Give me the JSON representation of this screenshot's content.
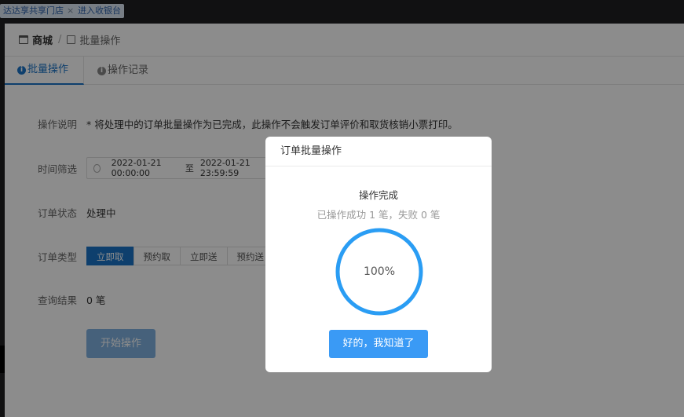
{
  "topbar": {
    "tabs": [
      {
        "label": "达达享共享门店",
        "close": "×"
      },
      {
        "label": "进入收银台"
      }
    ]
  },
  "breadcrumb": {
    "root": "商城",
    "separator": "/",
    "current": "批量操作"
  },
  "tabs": {
    "active": "批量操作",
    "inactive": "操作记录"
  },
  "form": {
    "desc_label": "操作说明",
    "desc_value": "* 将处理中的订单批量操作为已完成，此操作不会触发订单评价和取货核销小票打印。",
    "time_label": "时间筛选",
    "time_start": "2022-01-21 00:00:00",
    "time_sep": "至",
    "time_end": "2022-01-21 23:59:59",
    "status_label": "订单状态",
    "status_value": "处理中",
    "type_label": "订单类型",
    "type_options": [
      "立即取",
      "预约取",
      "立即送",
      "预约送"
    ],
    "result_label": "查询结果",
    "result_value": "0 笔",
    "start_button": "开始操作"
  },
  "modal": {
    "title": "订单批量操作",
    "status": "操作完成",
    "summary": "已操作成功 1 笔，失败 0 笔",
    "progress_percent": 100,
    "progress_label": "100%",
    "ok_button": "好的，我知道了"
  },
  "colors": {
    "primary": "#1a73c7",
    "ring": "#2a9df4",
    "ok_button": "#3a9af5"
  }
}
